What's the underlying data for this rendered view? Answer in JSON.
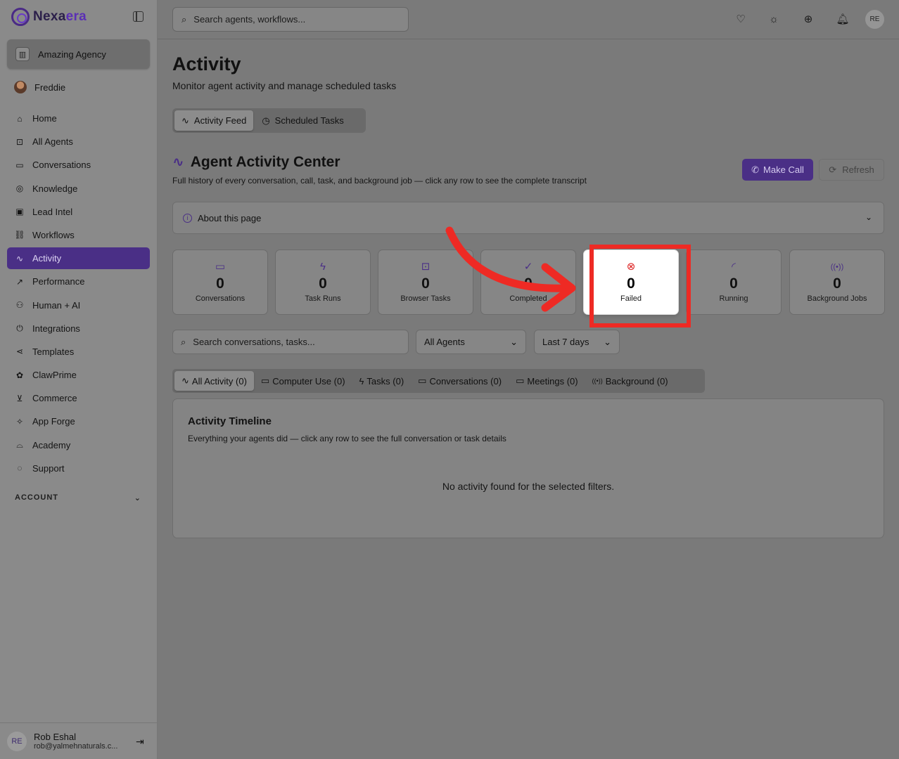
{
  "brand": {
    "name_part1": "Nexa",
    "name_part2": "era"
  },
  "sidebar": {
    "agency": "Amazing Agency",
    "user": "Freddie",
    "items": [
      {
        "label": "Home",
        "icon": "home-icon",
        "glyph": "⌂"
      },
      {
        "label": "All Agents",
        "icon": "bot-icon",
        "glyph": "⊡"
      },
      {
        "label": "Conversations",
        "icon": "chat-icon",
        "glyph": "▭"
      },
      {
        "label": "Knowledge",
        "icon": "brain-icon",
        "glyph": "◎"
      },
      {
        "label": "Lead Intel",
        "icon": "contact-icon",
        "glyph": "▣"
      },
      {
        "label": "Workflows",
        "icon": "workflow-icon",
        "glyph": "⛓"
      },
      {
        "label": "Activity",
        "icon": "activity-icon",
        "glyph": "∿"
      },
      {
        "label": "Performance",
        "icon": "trend-icon",
        "glyph": "↗"
      },
      {
        "label": "Human + AI",
        "icon": "network-icon",
        "glyph": "⚇"
      },
      {
        "label": "Integrations",
        "icon": "plug-icon",
        "glyph": "⏻"
      },
      {
        "label": "Templates",
        "icon": "share-icon",
        "glyph": "⋖"
      },
      {
        "label": "ClawPrime",
        "icon": "paw-icon",
        "glyph": "✿"
      },
      {
        "label": "Commerce",
        "icon": "cart-icon",
        "glyph": "⊻"
      },
      {
        "label": "App Forge",
        "icon": "sparkle-icon",
        "glyph": "✧"
      },
      {
        "label": "Academy",
        "icon": "graduation-icon",
        "glyph": "⌓"
      },
      {
        "label": "Support",
        "icon": "help-icon",
        "glyph": "◌"
      }
    ],
    "account_label": "ACCOUNT",
    "bottom_user": {
      "initials": "RE",
      "name": "Rob Eshal",
      "email": "rob@yalmehnaturals.c..."
    }
  },
  "topbar": {
    "search_placeholder": "Search agents, workflows...",
    "avatar": "RE"
  },
  "page": {
    "title": "Activity",
    "subtitle": "Monitor agent activity and manage scheduled tasks",
    "tabs": [
      "Activity Feed",
      "Scheduled Tasks"
    ],
    "section_title": "Agent Activity Center",
    "section_subtitle": "Full history of every conversation, call, task, and background job — click any row to see the complete transcript",
    "make_call": "Make Call",
    "refresh": "Refresh",
    "about": "About this page"
  },
  "stats": [
    {
      "value": "0",
      "label": "Conversations",
      "icon": "chat-icon",
      "glyph": "▭"
    },
    {
      "value": "0",
      "label": "Task Runs",
      "icon": "zap-icon",
      "glyph": "ϟ"
    },
    {
      "value": "0",
      "label": "Browser Tasks",
      "icon": "monitor-icon",
      "glyph": "⊡"
    },
    {
      "value": "0",
      "label": "Completed",
      "icon": "check-circle-icon",
      "glyph": "✓"
    },
    {
      "value": "0",
      "label": "Failed",
      "icon": "x-circle-icon",
      "glyph": "⊗"
    },
    {
      "value": "0",
      "label": "Running",
      "icon": "loader-icon",
      "glyph": "◜"
    },
    {
      "value": "0",
      "label": "Background Jobs",
      "icon": "radio-icon",
      "glyph": "((•))"
    }
  ],
  "filters": {
    "search_placeholder": "Search conversations, tasks...",
    "agents": "All Agents",
    "range": "Last 7 days"
  },
  "filter_tabs": [
    {
      "label": "All Activity (0)",
      "glyph": "∿"
    },
    {
      "label": "Computer Use (0)",
      "glyph": "▭"
    },
    {
      "label": "Tasks (0)",
      "glyph": "ϟ"
    },
    {
      "label": "Conversations (0)",
      "glyph": "▭"
    },
    {
      "label": "Meetings (0)",
      "glyph": "▭"
    },
    {
      "label": "Background (0)",
      "glyph": "((•))"
    }
  ],
  "timeline": {
    "title": "Activity Timeline",
    "subtitle": "Everything your agents did — click any row to see the full conversation or task details",
    "empty": "No activity found for the selected filters."
  },
  "colors": {
    "accent": "#4a2f86",
    "highlight": "#ee2a24"
  }
}
